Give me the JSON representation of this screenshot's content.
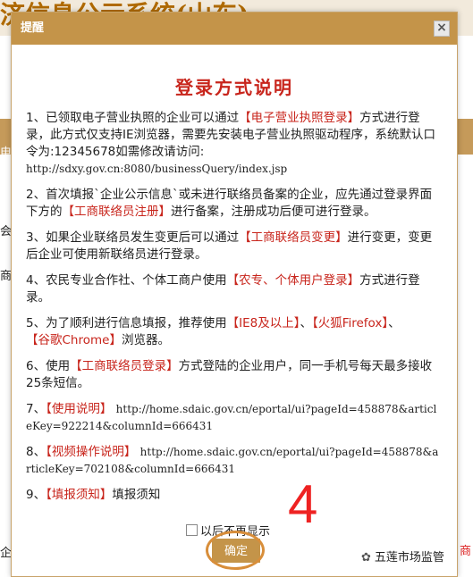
{
  "background": {
    "header_text": "济信息公示系统(山东)",
    "edge_texts": [
      "电",
      "会",
      "商",
      "企"
    ],
    "right_label": "商",
    "watermark": "五莲市场监管"
  },
  "dialog": {
    "titlebar": "提醒",
    "close_glyph": "×",
    "heading": "登录方式说明",
    "items": [
      {
        "pre": "1、已领取电子营业执照的企业可以通过",
        "red": "【电子营业执照登录】",
        "post": "方式进行登录，此方式仅支持IE浏览器，需要先安装电子营业执照驱动程序，系统默认口令为:12345678如需修改请访问:",
        "url": "http://sdxy.gov.cn:8080/businessQuery/index.jsp"
      },
      {
        "pre": "2、首次填报`企业公示信息`或未进行联络员备案的企业，应先通过登录界面下方的",
        "red": "【工商联络员注册】",
        "post": "进行备案，注册成功后便可进行登录。",
        "url": ""
      },
      {
        "pre": "3、如果企业联络员发生变更后可以通过",
        "red": "【工商联络员变更】",
        "post": "进行变更，变更后企业可使用新联络员进行登录。",
        "url": ""
      },
      {
        "pre": "4、农民专业合作社、个体工商户使用",
        "red": "【农专、个体用户登录】",
        "post": "方式进行登录。",
        "url": ""
      },
      {
        "pre": "5、为了顺利进行信息填报，推荐使用",
        "red": "【IE8及以上】",
        "post": "、",
        "red2": "【火狐Firefox】",
        "post2": "、",
        "red3": "【谷歌Chrome】",
        "post3": "浏览器。"
      },
      {
        "pre": "6、使用",
        "red": "【工商联络员登录】",
        "post": "方式登陆的企业用户，同一手机号每天最多接收25条短信。",
        "url": ""
      },
      {
        "pre": "7、",
        "red": "【使用说明】",
        "post": "",
        "url": "http://home.sdaic.gov.cn/eportal/ui?pageId=458878&articleKey=922214&columnId=666431"
      },
      {
        "pre": "8、",
        "red": "【视频操作说明】",
        "post": "",
        "url": "http://home.sdaic.gov.cn/eportal/ui?pageId=458878&articleKey=702108&columnId=666431"
      },
      {
        "pre": "9、",
        "red": "【填报须知】",
        "post": "填报须知",
        "url": ""
      }
    ],
    "checkbox_label": "以后不再显示",
    "confirm_label": "确定"
  },
  "annotation": {
    "number": "4"
  }
}
